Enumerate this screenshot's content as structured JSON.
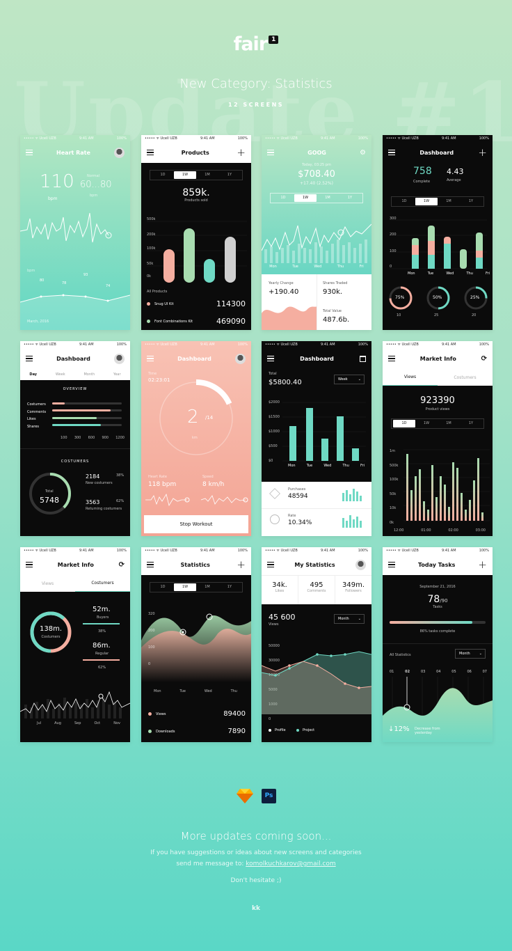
{
  "header": {
    "brand": "fair",
    "badge": "1",
    "bg_text": "Update #1",
    "title": "New Category: Statistics",
    "subtitle": "12 SCREENS"
  },
  "status": {
    "carrier": "••••• ᯤ Ucell UZB",
    "time": "9:41 AM",
    "battery": "100%"
  },
  "s1": {
    "title": "Heart Rate",
    "bpm": "110",
    "bpm_unit": "bpm",
    "normal_label": "Normal",
    "normal": "60...80",
    "normal_unit": "bpm",
    "axis": "bpm",
    "pts": [
      "80",
      "78",
      "93",
      "74",
      "12",
      "14",
      "15",
      "13",
      "15"
    ],
    "date": "March, 2016"
  },
  "s2": {
    "title": "Products",
    "tabs": [
      "1D",
      "1W",
      "1M",
      "1Y"
    ],
    "total": "859k.",
    "total_label": "Products sold",
    "y": [
      "500k",
      "200k",
      "100k",
      "50k",
      "0k"
    ],
    "list_title": "All Products",
    "items": [
      {
        "name": "Snug UI Kit",
        "sub": "UI Kit",
        "value": "114300"
      },
      {
        "name": "Font Combinations Kit",
        "sub": "UI Kit",
        "value": "469090"
      }
    ]
  },
  "s3": {
    "title": "GOOG",
    "date": "Today, 03:25 pm",
    "price": "$708.40",
    "change": "+17.40 (2.52%)",
    "tabs": [
      "1D",
      "1W",
      "1M",
      "1Y"
    ],
    "days": [
      "Mon",
      "Tue",
      "Wed",
      "Thu",
      "Fri"
    ],
    "yc_label": "Yearly Change",
    "yc": "+190.40",
    "st_label": "Shares Traded",
    "st": "930k.",
    "tv_label": "Total Value",
    "tv": "487.6b."
  },
  "s4": {
    "title": "Dashboard",
    "complete": "758",
    "complete_label": "Complete",
    "avg": "4.43",
    "avg_label": "Average",
    "tabs": [
      "1D",
      "1W",
      "1M",
      "1Y"
    ],
    "y": [
      "300",
      "200",
      "100",
      "0"
    ],
    "days": [
      "Mon",
      "Tue",
      "Wed",
      "Thu",
      "Fri"
    ],
    "rings": [
      {
        "pct": "75%",
        "a": "10",
        "b": "1M"
      },
      {
        "pct": "50%",
        "a": "25",
        "b": "1M"
      },
      {
        "pct": "25%",
        "a": "20",
        "b": "1M"
      }
    ]
  },
  "s5": {
    "title": "Dashboard",
    "tabs": [
      "Day",
      "Week",
      "Month",
      "Year"
    ],
    "overview": "OVERVIEW",
    "bars": [
      "Costumers",
      "Comments",
      "Likes",
      "Shares"
    ],
    "x": [
      "100",
      "300",
      "600",
      "900",
      "1200"
    ],
    "cust": "COSTUMERS",
    "total_label": "Total",
    "total": "5748",
    "new": "2184",
    "new_label": "New costumers",
    "new_pct": "38%",
    "ret": "3563",
    "ret_label": "Returning costumers",
    "ret_pct": "62%"
  },
  "s6": {
    "title": "Dashboard",
    "time_label": "Time",
    "time": "02:23:01",
    "big": "2",
    "of": "/14",
    "unit": "km",
    "hr_label": "Heart Rate",
    "hr": "118 bpm",
    "sp_label": "Speed",
    "sp": "8 km/h",
    "stop": "Stop Workout"
  },
  "s7": {
    "title": "Dashboard",
    "total_label": "Total",
    "total": "$5800.40",
    "sel": "Week",
    "y": [
      "$2000",
      "$1500",
      "$1000",
      "$500",
      "$0"
    ],
    "days": [
      "Mon",
      "Tue",
      "Wed",
      "Thu",
      "Fri"
    ],
    "p_label": "Purchases",
    "p": "48594",
    "r_label": "Rate",
    "r": "10.34%"
  },
  "s8": {
    "title": "Market Info",
    "tabs": [
      "Views",
      "Costumers"
    ],
    "views": "923390",
    "views_label": "Product views",
    "tt": [
      "1D",
      "1W",
      "1M",
      "1Y"
    ],
    "y": [
      "1m",
      "500k",
      "100k",
      "50k",
      "10k",
      "0k"
    ],
    "x": [
      "12:00",
      "01:00",
      "02:00",
      "03:00"
    ]
  },
  "s9": {
    "title": "Market Info",
    "tabs": [
      "Views",
      "Costumers"
    ],
    "center": "138m.",
    "center_label": "Costumers",
    "buyers": "52m.",
    "buyers_label": "Buyers",
    "buyers_pct": "38%",
    "regular": "86m.",
    "regular_label": "Regular",
    "regular_pct": "62%",
    "months": [
      "Jul",
      "Aug",
      "Sep",
      "Oct",
      "Nov"
    ]
  },
  "s10": {
    "title": "Statistics",
    "tabs": [
      "1D",
      "1W",
      "1M",
      "1Y"
    ],
    "y": [
      "320",
      "200",
      "100",
      "0"
    ],
    "days": [
      "Mon",
      "Tue",
      "Wed",
      "Thu"
    ],
    "l1": "Views",
    "v1": "89400",
    "l2": "Downloads",
    "v2": "7890"
  },
  "s11": {
    "title": "My Statistics",
    "likes": "34k.",
    "likes_label": "Likes",
    "comments": "495",
    "comments_label": "Comments",
    "followers": "349m.",
    "followers_label": "Followers",
    "views": "45 600",
    "views_label": "Views",
    "sel": "Month",
    "y": [
      "50000",
      "30000",
      "10000",
      "5000",
      "1000",
      "0"
    ],
    "l1": "Profile",
    "l2": "Project"
  },
  "s12": {
    "title": "Today Tasks",
    "date": "September 21, 2016",
    "done": "78",
    "of": "/90",
    "label": "Tasks",
    "pct_text": "86% tasks complete",
    "all": "All Statistics",
    "sel": "Month",
    "days": [
      "01",
      "02",
      "03",
      "04",
      "05",
      "06",
      "07"
    ],
    "dec": "↓12%",
    "dec_text": "Decrease from yesterday"
  },
  "footer": {
    "title": "More updates coming soon...",
    "line1": "If you have suggestions or ideas about new screens and categories",
    "line2": "send me message to:",
    "email": "komolkuchkarov@gmail.com",
    "line3": "Don't hesitate ;)",
    "sign": "kk",
    "sketch_icon": "sketch-icon",
    "ps_label": "Ps"
  },
  "colors": {
    "mint": "#6fd9c4",
    "pink": "#f5aea0",
    "green": "#a8dcb0",
    "dark": "#0b0b0b"
  }
}
